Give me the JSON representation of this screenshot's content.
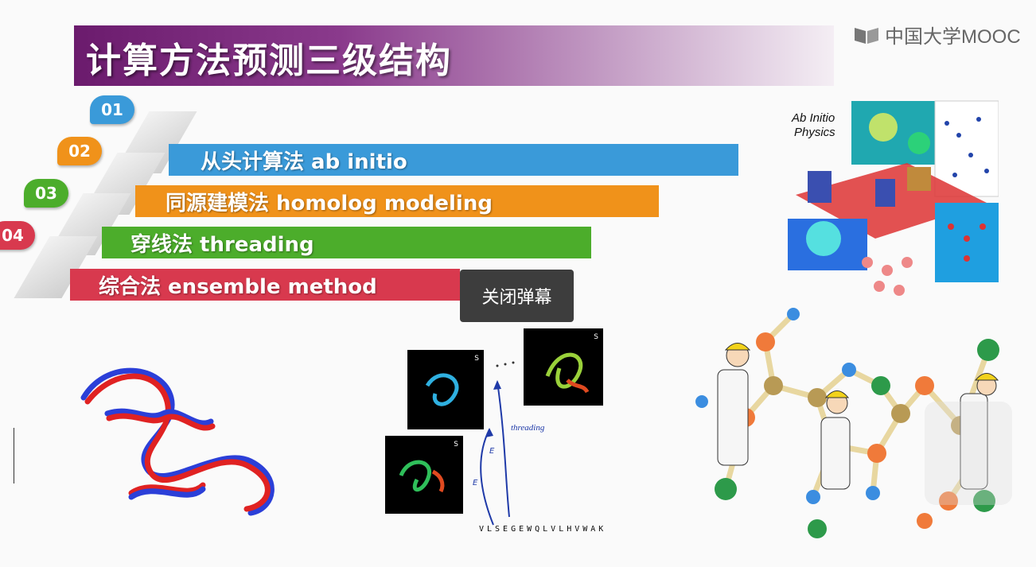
{
  "slide": {
    "title": "计算方法预测三级结构",
    "logo_text": "中国大学MOOC",
    "methods": [
      {
        "num": "01",
        "label": "从头计算法 ab initio",
        "color": "#3a9ad9"
      },
      {
        "num": "02",
        "label": "同源建模法 homolog modeling",
        "color": "#f0921a"
      },
      {
        "num": "03",
        "label": "穿线法 threading",
        "color": "#4cad2b"
      },
      {
        "num": "04",
        "label": "综合法 ensemble method",
        "color": "#d8394e"
      }
    ],
    "ab_initio_label_1": "Ab Initio",
    "ab_initio_label_2": "Physics",
    "threading_word": "threading",
    "threading_sequence": "VLSEGEWQLVLHVWAK",
    "s1": "S",
    "s2": "S",
    "s3": "S",
    "e1": "E",
    "e2": "E"
  },
  "overlay": {
    "close_danmaku": "关闭弹幕"
  }
}
